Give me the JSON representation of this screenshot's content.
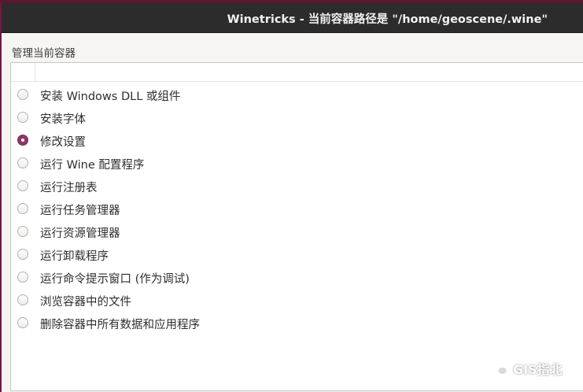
{
  "window": {
    "title": "Winetricks - 当前容器路径是 \"/home/geoscene/.wine\""
  },
  "section": {
    "label": "管理当前容器"
  },
  "options": [
    {
      "label": "安装 Windows DLL 或组件",
      "checked": false
    },
    {
      "label": "安装字体",
      "checked": false
    },
    {
      "label": "修改设置",
      "checked": true
    },
    {
      "label": "运行 Wine 配置程序",
      "checked": false
    },
    {
      "label": "运行注册表",
      "checked": false
    },
    {
      "label": "运行任务管理器",
      "checked": false
    },
    {
      "label": "运行资源管理器",
      "checked": false
    },
    {
      "label": "运行卸载程序",
      "checked": false
    },
    {
      "label": "运行命令提示窗口 (作为调试)",
      "checked": false
    },
    {
      "label": "浏览容器中的文件",
      "checked": false
    },
    {
      "label": "删除容器中所有数据和应用程序",
      "checked": false
    }
  ],
  "watermark": {
    "text": "GIS指北",
    "icon": "wechat-icon"
  },
  "colors": {
    "titlebar": "#2c2c2c",
    "radio_checked": "#8a3a64",
    "desktop": "#6e1a3e"
  }
}
